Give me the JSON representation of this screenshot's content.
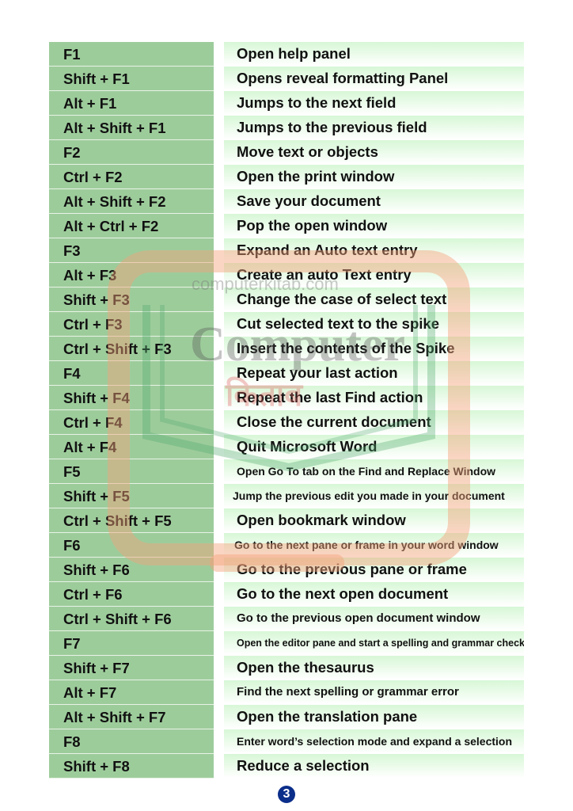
{
  "shortcuts": [
    {
      "key": "F1",
      "action": "Open help panel"
    },
    {
      "key": "Shift + F1",
      "action": "Opens reveal formatting Panel"
    },
    {
      "key": "Alt + F1",
      "action": "Jumps to the next field"
    },
    {
      "key": "Alt + Shift + F1",
      "action": "Jumps to the previous field"
    },
    {
      "key": "F2",
      "action": "Move text or objects"
    },
    {
      "key": "Ctrl + F2",
      "action": "Open the print window"
    },
    {
      "key": "Alt + Shift + F2",
      "action": "Save your document"
    },
    {
      "key": "Alt + Ctrl + F2",
      "action": "Pop the open window"
    },
    {
      "key": "F3",
      "action": "Expand an Auto text entry"
    },
    {
      "key": "Alt + F3",
      "action": "Create an auto Text entry"
    },
    {
      "key": "Shift + F3",
      "action": "Change the case of select text"
    },
    {
      "key": "Ctrl + F3",
      "action": "Cut selected text to the spike"
    },
    {
      "key": "Ctrl + Shift + F3",
      "action": "Insert the contents of the Spike"
    },
    {
      "key": "F4",
      "action": "Repeat your last action"
    },
    {
      "key": "Shift + F4",
      "action": "Repeat the last Find action"
    },
    {
      "key": "Ctrl + F4",
      "action": "Close the current document"
    },
    {
      "key": "Alt + F4",
      "action": "Quit Microsoft Word"
    },
    {
      "key": "F5",
      "action": "Open Go To tab on the Find and Replace Window"
    },
    {
      "key": "Shift + F5",
      "action": "Jump the previous edit you made in your document"
    },
    {
      "key": "Ctrl + Shift + F5",
      "action": "Open bookmark window"
    },
    {
      "key": "F6",
      "action": "Go to the next pane or frame in your word window"
    },
    {
      "key": "Shift + F6",
      "action": "Go to the previous pane or frame"
    },
    {
      "key": "Ctrl + F6",
      "action": "Go to the next open document"
    },
    {
      "key": "Ctrl + Shift + F6",
      "action": "Go to the previous open document window"
    },
    {
      "key": "F7",
      "action": "Open the editor pane and start a spelling and grammar check"
    },
    {
      "key": "Shift + F7",
      "action": "Open the thesaurus"
    },
    {
      "key": "Alt + F7",
      "action": "Find the next spelling or grammar error"
    },
    {
      "key": "Alt + Shift + F7",
      "action": "Open the translation pane"
    },
    {
      "key": "F8",
      "action": "Enter word’s selection mode and expand a selection"
    },
    {
      "key": "Shift + F8",
      "action": "Reduce a selection"
    }
  ],
  "watermark": {
    "site": "computerkitab.com",
    "word": "Computer",
    "hindi": "किताब"
  },
  "page_number": "3",
  "colors": {
    "key_bg": "#9dcc9b",
    "desc_top": "#d7f7d6",
    "page_badge": "#0b2e8a"
  }
}
